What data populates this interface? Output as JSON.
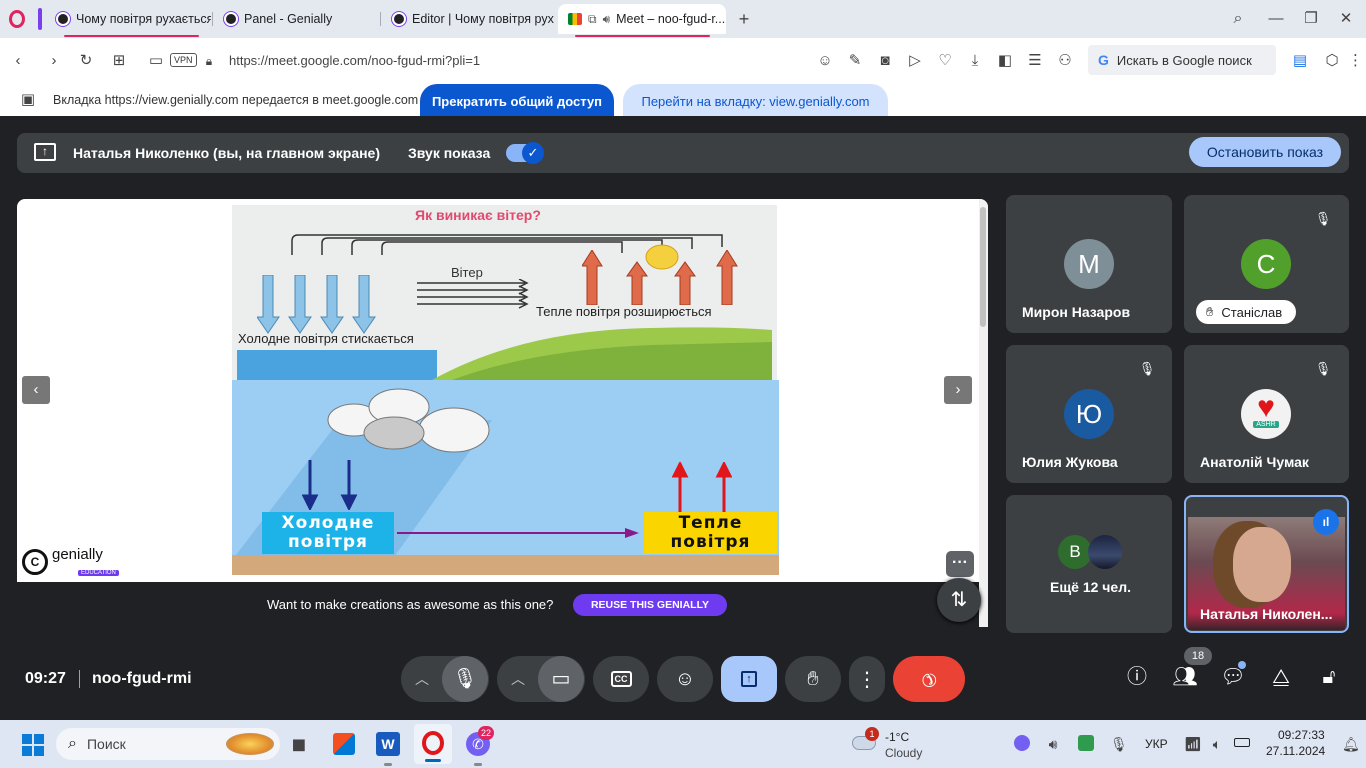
{
  "tabs": [
    {
      "title": "Чому повітря рухається?"
    },
    {
      "title": "Panel - Genially"
    },
    {
      "title": "Editor | Чому повітря рух..."
    },
    {
      "title": "Meet – noo-fgud-r..."
    }
  ],
  "address": {
    "vpn": "VPN",
    "url": "https://meet.google.com/noo-fgud-rmi?pli=1",
    "search_placeholder": "Искать в Google поиск"
  },
  "share_banner": {
    "message": "Вкладка https://view.genially.com передается в meet.google.com",
    "stop_sharing": "Прекратить общий доступ",
    "go_to_tab": "Перейти на вкладку: view.genially.com"
  },
  "presenting": {
    "presenter": "Наталья Николенко (вы, на главном экране)",
    "audio_label": "Звук показа",
    "stop_button": "Остановить показ"
  },
  "slide": {
    "top_title": "Як виникає вітер?",
    "wind": "Вітер",
    "cold_compress": "Холодне повітря стискається",
    "warm_expand": "Тепле повітря розширюється",
    "cold_box": [
      "Холодне",
      "повітря"
    ],
    "warm_box": [
      "Тепле",
      "повітря"
    ],
    "genially_brand": "genially",
    "genially_sub": "EDUCATION",
    "reuse_prompt": "Want to make creations as awesome as this one?",
    "reuse_button": "REUSE THIS GENIALLY",
    "more_dots": "···"
  },
  "participants": [
    {
      "name": "Мирон Назаров",
      "initial": "М",
      "color": "#7e8f98"
    },
    {
      "name": "Станіслав",
      "initial": "C",
      "color": "#51a02c"
    },
    {
      "name": "Юлия Жукова",
      "initial": "Ю",
      "color": "#1a5aa0"
    },
    {
      "name": "Анатолій Чумак",
      "initial": "ASHR",
      "color": "#f2f2f2"
    },
    {
      "name": "Ещё 12 чел.",
      "initial": "B",
      "color": "#2f6d2f"
    },
    {
      "name": "Наталья Николен...",
      "initial": "",
      "color": "#6b4a52"
    }
  ],
  "meeting": {
    "time": "09:27",
    "code": "noo-fgud-rmi",
    "people_count": "18"
  },
  "taskbar": {
    "search": "Поиск",
    "weather_temp": "-1°C",
    "weather_desc": "Cloudy",
    "weather_badge": "1",
    "viber_badge": "22",
    "lang": "УКР",
    "clock_time": "09:27:33",
    "clock_date": "27.11.2024"
  },
  "colors": {
    "meet_bg": "#202124",
    "tile_bg": "#3c4043",
    "accent_blue": "#8ab4f8",
    "end_call": "#ea4335",
    "genially_purple": "#6e3bf0"
  }
}
